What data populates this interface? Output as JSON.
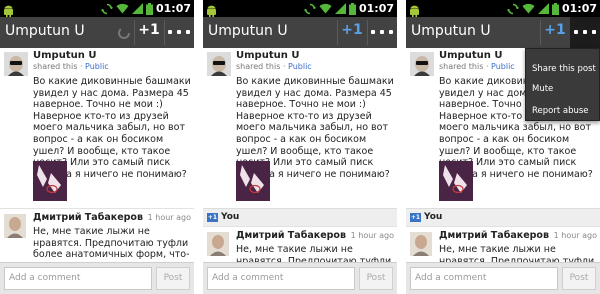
{
  "status_bar": {
    "time": "01:07"
  },
  "action_bar": {
    "title": "Umputun U",
    "plus_one_label": "+1"
  },
  "post": {
    "author": "Umputun U",
    "audience_prefix": "shared this ·",
    "audience": "Public",
    "text": "Во какие диковинные башмаки увидел у нас дома. Размера 45 наверное. Точно не мои :) Наверное кто-то из друзей моего мальчика забыл, но вот вопрос - а как он босиком ушел? И вообще, кто такое носит? Или это самый писк моды, а я ничего не понимаю?"
  },
  "plus_ones": {
    "you_label": "You",
    "badge": "+1"
  },
  "comment": {
    "author": "Дмитрий Табакеров",
    "time": "1 hour ago",
    "text_full": "Не, мне такие лыжи не нравятся. Предпочитаю туфли более анатомичных форм, что-то среднее",
    "text_short": "Не, мне такие лыжи не нравятся. Предпочитаю туфли более"
  },
  "composer": {
    "placeholder": "Add a comment",
    "post_label": "Post"
  },
  "menu": {
    "items": [
      "Share this post",
      "Mute",
      "Report abuse"
    ]
  },
  "colors": {
    "action_bar": "#424242",
    "plus_one_active": "#5aa0e6",
    "link": "#3b6ec8",
    "status_green": "#55b83a"
  }
}
